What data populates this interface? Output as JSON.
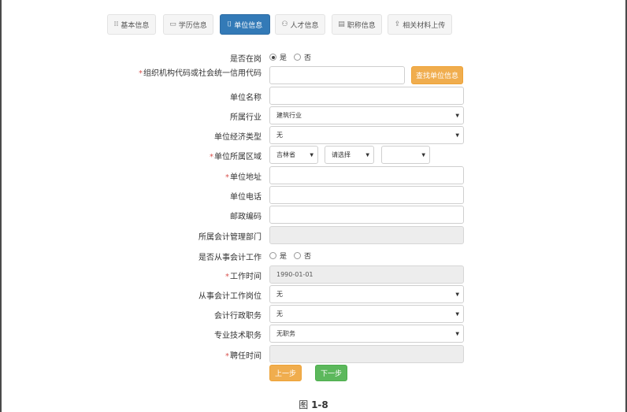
{
  "tabs": [
    {
      "label": "基本信息",
      "icon": "bars-icon",
      "icon_glyph": "⁞⁞"
    },
    {
      "label": "学历信息",
      "icon": "comment-icon",
      "icon_glyph": "▭"
    },
    {
      "label": "单位信息",
      "icon": "book-icon",
      "icon_glyph": "⌷"
    },
    {
      "label": "人才信息",
      "icon": "user-icon",
      "icon_glyph": "⚇"
    },
    {
      "label": "职称信息",
      "icon": "document-icon",
      "icon_glyph": "▤"
    },
    {
      "label": "相关材料上传",
      "icon": "upload-icon",
      "icon_glyph": "⇪"
    }
  ],
  "active_tab": "单位信息",
  "colors": {
    "primary": "#337ab7",
    "warning": "#f0ad4e",
    "success": "#5cb85c",
    "required": "#d9534f"
  },
  "form": {
    "on_duty": {
      "label": "是否在岗",
      "yes": "是",
      "no": "否",
      "selected": "是"
    },
    "org_code": {
      "label": "组织机构代码或社会统一信用代码",
      "value": "",
      "lookup_button": "查找单位信息"
    },
    "unit_name": {
      "label": "单位名称",
      "value": ""
    },
    "industry": {
      "label": "所属行业",
      "value": "建筑行业"
    },
    "economy_type": {
      "label": "单位经济类型",
      "value": "无"
    },
    "region": {
      "label": "单位所属区域",
      "province": "吉林省",
      "city": "请选择",
      "district": ""
    },
    "address": {
      "label": "单位地址",
      "value": ""
    },
    "phone": {
      "label": "单位电话",
      "value": ""
    },
    "postcode": {
      "label": "邮政编码",
      "value": ""
    },
    "accounting_dept": {
      "label": "所属会计管理部门",
      "value": ""
    },
    "is_accounting": {
      "label": "是否从事会计工作",
      "yes": "是",
      "no": "否",
      "selected": ""
    },
    "work_time": {
      "label": "工作时间",
      "value": "1990-01-01"
    },
    "accounting_post": {
      "label": "从事会计工作岗位",
      "value": "无"
    },
    "admin_position": {
      "label": "会计行政职务",
      "value": "无"
    },
    "tech_position": {
      "label": "专业技术职务",
      "value": "无职务"
    },
    "hire_time": {
      "label": "聘任时间",
      "value": ""
    }
  },
  "buttons": {
    "prev": "上一步",
    "next": "下一步"
  },
  "caption": {
    "prefix": "图",
    "number": "1-8"
  },
  "required_mark": "*",
  "select_arrow": "▼"
}
